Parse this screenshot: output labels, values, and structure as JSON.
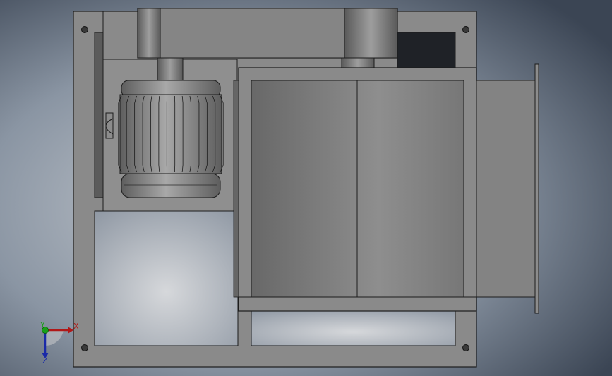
{
  "scene": {
    "background": {
      "left_color": "#3b4554",
      "center_color": "#c8ccd1",
      "right_color": "#3b4554"
    },
    "part_colors": {
      "frame": "#8a8a8a",
      "dark_gray": "#6f6f6f",
      "light_gray": "#9a9a9a",
      "outline": "#1c1c1c",
      "panel_opening": "#c3c6ca"
    },
    "components": [
      "frame-plate",
      "belt-guard",
      "electric-motor",
      "fan-housing",
      "outlet-duct",
      "flange"
    ]
  },
  "triad": {
    "x_label": "X",
    "y_label": "Y",
    "z_label": "Z",
    "x_color": "#b01818",
    "y_color": "#18a018",
    "z_color": "#1a2aa8"
  }
}
